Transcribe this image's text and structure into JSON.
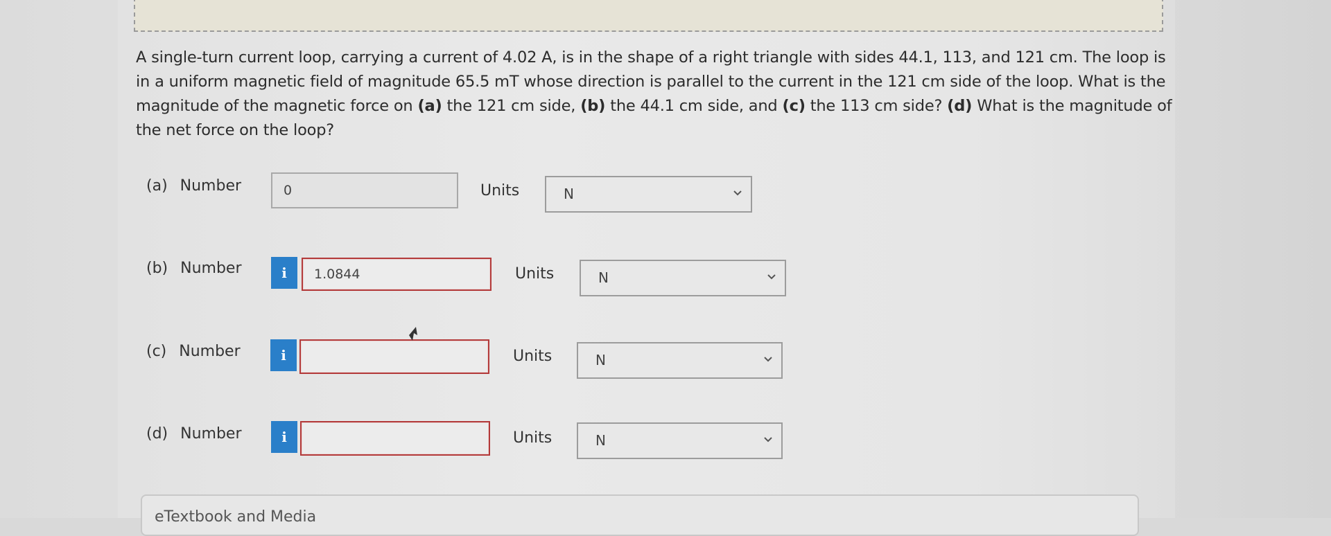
{
  "problem": {
    "text_1": "A single-turn current loop, carrying a current of 4.02 A, is in the shape of a right triangle with sides 44.1, 113, and 121 cm. The loop is in a uniform magnetic field of magnitude 65.5 mT whose direction is parallel to the current in the 121 cm side of the loop. What is the magnitude of the magnetic force on ",
    "a_tag": "(a)",
    "text_2": " the 121 cm side, ",
    "b_tag": "(b)",
    "text_3": " the 44.1 cm side, and ",
    "c_tag": "(c)",
    "text_4": " the 113 cm side? ",
    "d_tag": "(d)",
    "text_5": " What is the magnitude of the net force on the loop?"
  },
  "answers": [
    {
      "part": "(a)",
      "label": "Number",
      "value": "0",
      "units_label": "Units",
      "units_value": "N",
      "has_info": false
    },
    {
      "part": "(b)",
      "label": "Number",
      "value": "1.0844",
      "units_label": "Units",
      "units_value": "N",
      "has_info": true,
      "info_glyph": "i"
    },
    {
      "part": "(c)",
      "label": "Number",
      "value": "",
      "units_label": "Units",
      "units_value": "N",
      "has_info": true,
      "info_glyph": "i"
    },
    {
      "part": "(d)",
      "label": "Number",
      "value": "",
      "units_label": "Units",
      "units_value": "N",
      "has_info": true,
      "info_glyph": "i"
    }
  ],
  "footer": {
    "textbook_label": "eTextbook and Media"
  },
  "icons": {
    "info": "info-icon",
    "dropdown": "chevron-down-icon",
    "cursor": "mouse-cursor-icon"
  },
  "colors": {
    "info_button": "#2a7fc9",
    "error_border": "#b33a3a"
  }
}
